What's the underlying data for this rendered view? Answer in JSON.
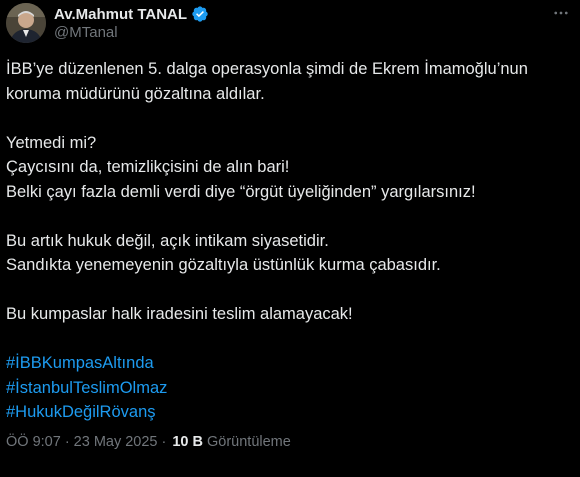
{
  "author": {
    "display_name": "Av.Mahmut TANAL",
    "handle": "@MTanal",
    "avatar_icon": "profile-photo",
    "verified_icon": "verified-badge-icon",
    "verified_color": "#1d9bf0"
  },
  "menu_icon": "more-horizontal-icon",
  "tweet": {
    "lines": [
      "İBB’ye düzenlenen 5. dalga operasyonla şimdi de Ekrem İmamoğlu’nun",
      "koruma müdürünü gözaltına aldılar.",
      "",
      "Yetmedi mi?",
      "Çaycısını da, temizlikçisini de alın bari!",
      "Belki çayı fazla demli verdi diye “örgüt üyeliğinden” yargılarsınız!",
      "",
      "Bu artık hukuk değil, açık intikam siyasetidir.",
      "Sandıkta yenemeyenin gözaltıyla üstünlük kurma çabasıdır.",
      "",
      "Bu kumpaslar halk iradesini teslim alamayacak!",
      ""
    ],
    "hashtags": [
      "#İBBKumpasAltında",
      "#İstanbulTeslimOlmaz",
      "#HukukDeğilRövanş"
    ]
  },
  "meta": {
    "time": "ÖÖ 9:07",
    "separator": "·",
    "date": "23 May 2025",
    "views_count": "10 B",
    "views_label": "Görüntüleme"
  },
  "colors": {
    "background": "#000000",
    "text": "#e7e9ea",
    "secondary": "#71767b",
    "link": "#1d9bf0"
  }
}
